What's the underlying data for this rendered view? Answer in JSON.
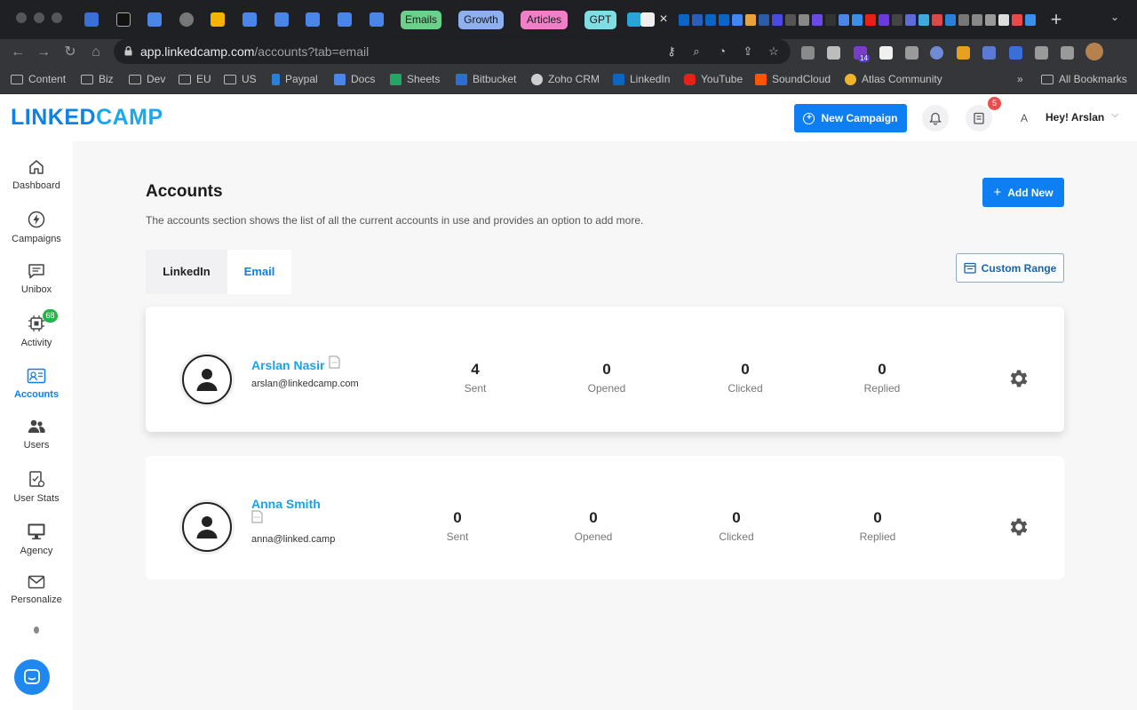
{
  "browser": {
    "url_host": "app.linkedcamp.com",
    "url_path": "/accounts?tab=email",
    "tab_chips": [
      {
        "label": "Emails",
        "color": "#6bd08a"
      },
      {
        "label": "Growth",
        "color": "#8fb0ee"
      },
      {
        "label": "Articles",
        "color": "#ef7fc6"
      },
      {
        "label": "GPT",
        "color": "#7fdde4"
      }
    ],
    "extension_badge": "14",
    "bookmarks": [
      "Content",
      "Biz",
      "Dev",
      "EU",
      "US",
      "Paypal",
      "Docs",
      "Sheets",
      "Bitbucket",
      "Zoho CRM",
      "LinkedIn",
      "YouTube",
      "SoundCloud",
      "Atlas Community"
    ],
    "all_bookmarks": "All Bookmarks",
    "overflow": "»"
  },
  "app": {
    "logo_part1": "LINKED",
    "logo_part2": "CAMP",
    "new_campaign": "New Campaign",
    "notif_count": "5",
    "avatar_initial": "A",
    "greeting": "Hey! Arslan"
  },
  "sidebar": {
    "items": [
      {
        "label": "Dashboard"
      },
      {
        "label": "Campaigns"
      },
      {
        "label": "Unibox"
      },
      {
        "label": "Activity",
        "badge": "68"
      },
      {
        "label": "Accounts"
      },
      {
        "label": "Users"
      },
      {
        "label": "User Stats"
      },
      {
        "label": "Agency"
      },
      {
        "label": "Personalize"
      }
    ]
  },
  "page": {
    "title": "Accounts",
    "description": "The accounts section shows the list of all the current accounts in use and provides an option to add more.",
    "add_new": "Add New",
    "tabs": [
      "LinkedIn",
      "Email"
    ],
    "active_tab": "Email",
    "custom_range": "Custom Range"
  },
  "accounts": [
    {
      "name": "Arslan Nasir",
      "email": "arslan@linkedcamp.com",
      "stats": [
        {
          "value": "4",
          "label": "Sent"
        },
        {
          "value": "0",
          "label": "Opened"
        },
        {
          "value": "0",
          "label": "Clicked"
        },
        {
          "value": "0",
          "label": "Replied"
        }
      ]
    },
    {
      "name": "Anna Smith",
      "email": "anna@linked.camp",
      "stats": [
        {
          "value": "0",
          "label": "Sent"
        },
        {
          "value": "0",
          "label": "Opened"
        },
        {
          "value": "0",
          "label": "Clicked"
        },
        {
          "value": "0",
          "label": "Replied"
        }
      ]
    }
  ]
}
